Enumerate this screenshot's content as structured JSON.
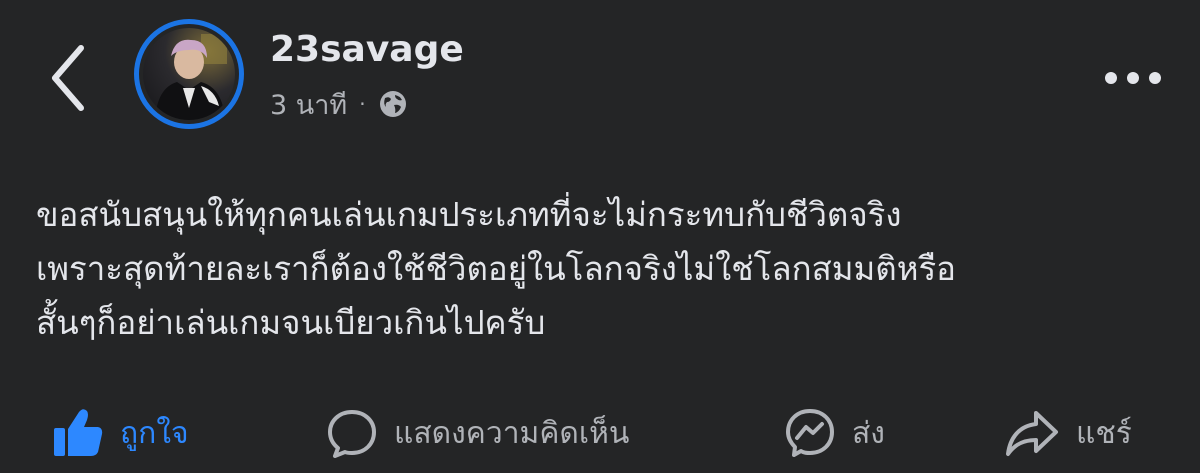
{
  "post": {
    "author": "23savage",
    "time": "3 นาที",
    "separator": "·",
    "privacy_icon": "globe-icon",
    "text_lines": [
      "ขอสนับสนุนให้ทุกคนเล่นเกมประเภทที่จะไม่กระทบกับชีวิตจริง",
      "เพราะสุดท้ายละเราก็ต้องใช้ชีวิตอยู่ในโลกจริงไม่ใช่โลกสมมติหรือ",
      "สั้นๆก็อย่าเล่นเกมจนเบียวเกินไปครับ"
    ]
  },
  "actions": {
    "like": "ถูกใจ",
    "comment": "แสดงความคิดเห็น",
    "send": "ส่ง",
    "share": "แชร์"
  },
  "colors": {
    "background": "#242526",
    "accent": "#2d88ff",
    "avatar_ring": "#1b74e4",
    "text_primary": "#e4e6eb",
    "text_secondary": "#b0b3b8"
  }
}
